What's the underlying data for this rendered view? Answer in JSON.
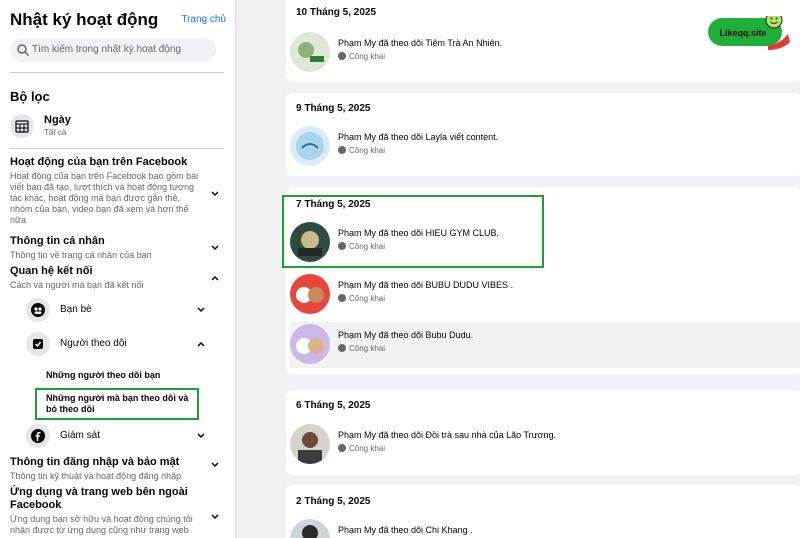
{
  "sidebar": {
    "title": "Nhật ký hoạt động",
    "home_link": "Trang chủ",
    "search_placeholder": "Tìm kiếm trong nhật ký hoạt động",
    "filter_title": "Bộ lọc",
    "date_filter": {
      "label": "Ngày",
      "sub": "Tất cả"
    },
    "categories": [
      {
        "title": "Hoạt động của bạn trên Facebook",
        "desc": "Hoạt động của bạn trên Facebook bao gồm bài viết bạn đã tạo, lượt thích và hoạt động tương tác khác, hoạt động mà bạn được gắn thẻ, nhóm của bạn, video bạn đã xem và hơn thế nữa"
      },
      {
        "title": "Thông tin cá nhân",
        "desc": "Thông tin về trang cá nhân của bạn"
      },
      {
        "title": "Quan hệ kết nối",
        "desc": "Cách và người mà bạn đã kết nối"
      },
      {
        "title": "Thông tin đăng nhập và bảo mật",
        "desc": "Thông tin kỹ thuật và hoạt động đăng nhập"
      },
      {
        "title": "Ứng dụng và trang web bên ngoài Facebook",
        "desc": "Ứng dụng bạn sở hữu và hoạt động chúng tôi nhận được từ ứng dụng cũng như trang web"
      }
    ],
    "subitems": [
      "Bạn bè",
      "Người theo dõi",
      "Giám sát"
    ],
    "sublinks": [
      "Những người theo dõi bạn",
      "Những người mà bạn theo dõi và bỏ theo dõi"
    ]
  },
  "feed": {
    "dates": [
      "10 Tháng 5, 2025",
      "9 Tháng 5, 2025",
      "7 Tháng 5, 2025",
      "6 Tháng 5, 2025",
      "2 Tháng 5, 2025"
    ],
    "privacy": "Công khai",
    "entries": [
      "Phạm My đã theo dõi Tiệm Trà An Nhiên.",
      "Phạm My đã theo dõi Layla viết content.",
      "Phạm My đã theo dõi HIEU GYM CLUB.",
      "Phạm My đã theo dõi BUBU DUDU VIBES .",
      "Phạm My đã theo dõi Bubu Dudu.",
      "Phạm My đã theo dõi Đồi trà sau nhà của Lão Trương.",
      "Phạm My đã theo dõi Chi Khang ."
    ]
  },
  "watermark": "Likeqq.site",
  "colors": {
    "accent": "#1877f2",
    "highlight": "#1aa033"
  }
}
